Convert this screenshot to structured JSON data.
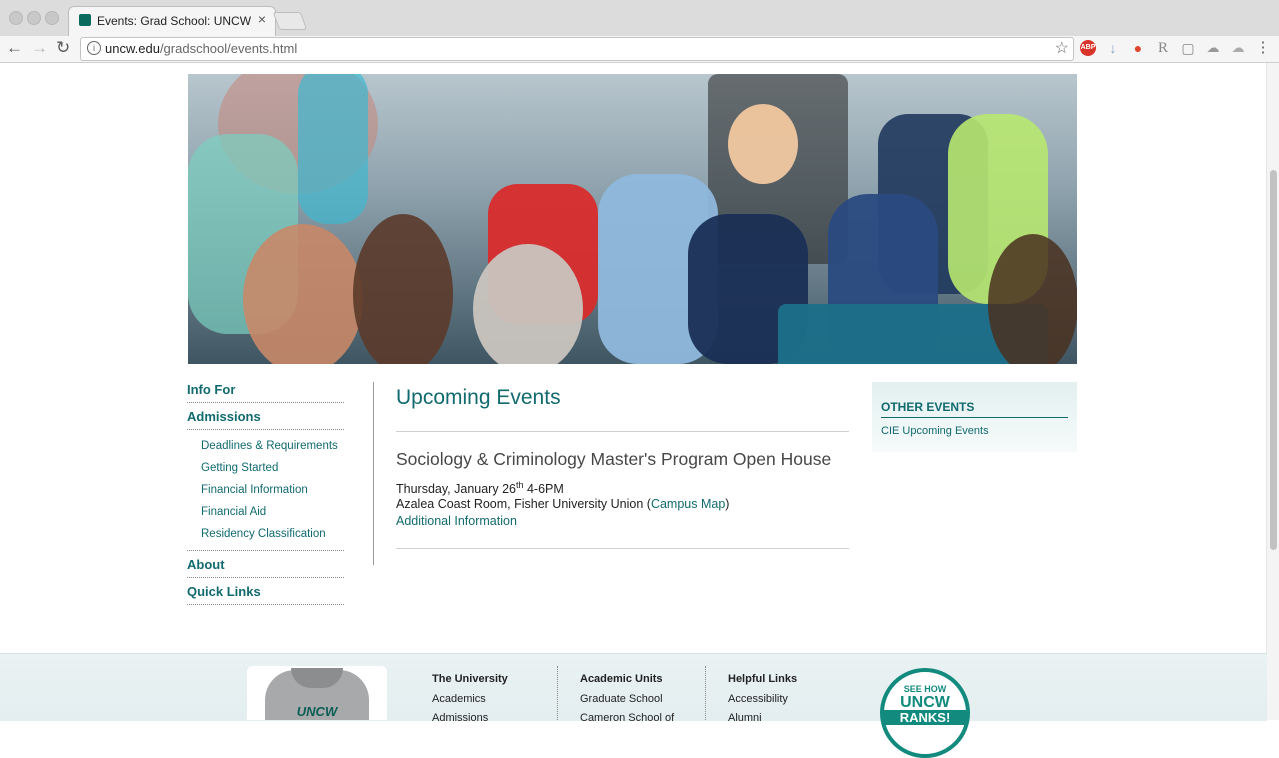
{
  "browser": {
    "tab_title": "Events: Grad School: UNCW",
    "tab_close": "×",
    "url_domain": "uncw.edu",
    "url_path": "/gradschool/events.html",
    "info_glyph": "i",
    "back_glyph": "←",
    "forward_glyph": "→",
    "reload_glyph": "↻",
    "star_glyph": "☆",
    "menu_glyph": "⋮",
    "extensions": [
      "ABP",
      "↓",
      "●",
      "R",
      "▢",
      "☁",
      "☁"
    ]
  },
  "leftnav": {
    "info_for": "Info For",
    "admissions": "Admissions",
    "admissions_items": [
      "Deadlines & Requirements",
      "Getting Started",
      "Financial Information",
      "Financial Aid",
      "Residency Classification"
    ],
    "about": "About",
    "quick_links": "Quick Links"
  },
  "main": {
    "heading": "Upcoming Events",
    "event": {
      "title": "Sociology & Criminology Master's Program Open House",
      "date_prefix": "Thursday, January 26",
      "date_sup": "th",
      "time": " 4-6PM",
      "location": "Azalea Coast Room, Fisher University Union (",
      "campus_map": "Campus Map",
      "location_end": ")",
      "additional": "Additional Information"
    }
  },
  "sidebar": {
    "heading": "OTHER EVENTS",
    "link": "CIE Upcoming Events"
  },
  "footer": {
    "col1_title": "The University",
    "col1_items": [
      "Academics",
      "Admissions"
    ],
    "col2_title": "Academic Units",
    "col2_items": [
      "Graduate School",
      "Cameron School of"
    ],
    "col3_title": "Helpful Links",
    "col3_items": [
      "Accessibility",
      "Alumni"
    ],
    "badge_line1": "SEE HOW",
    "badge_line2": "UNCW",
    "badge_line3": "RANKS!",
    "shirt_logo": "UNCW"
  },
  "colors": {
    "teal_link": "#116a6e",
    "badge_teal": "#128a7e"
  }
}
